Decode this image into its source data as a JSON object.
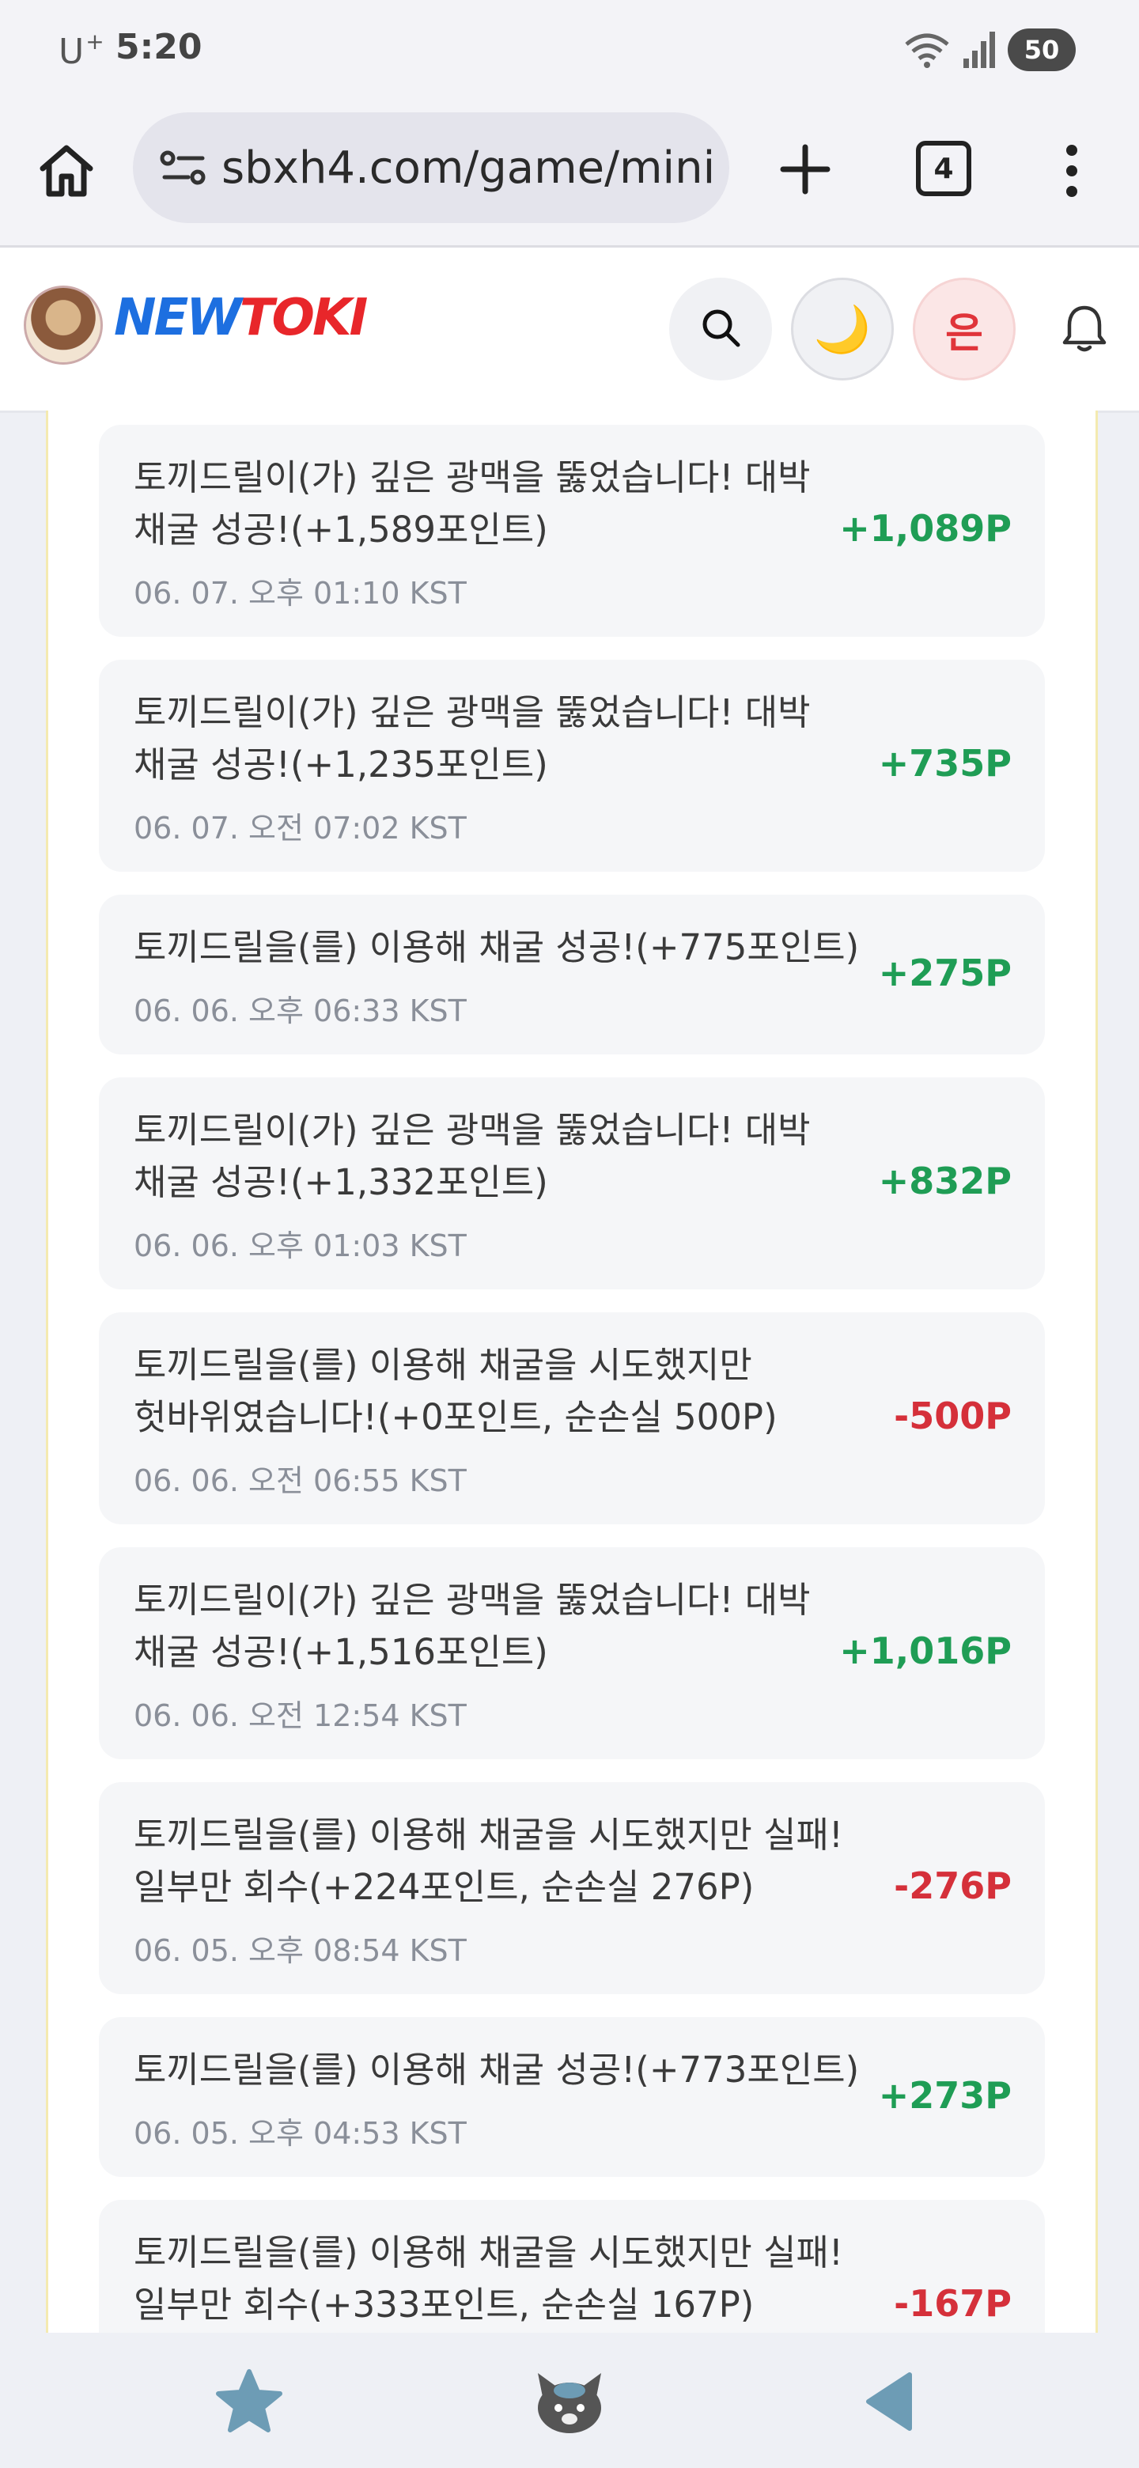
{
  "status_bar": {
    "carrier": "U",
    "carrier_plus": "+",
    "time": "5:20",
    "battery": "50"
  },
  "browser": {
    "url": "sbxh4.com/game/mini",
    "tab_count": "4"
  },
  "site": {
    "logo_new": "NEW",
    "logo_toki": "TOKI",
    "user_initial": "은",
    "theme_icon": "🌙"
  },
  "entries": [
    {
      "message": "토끼드릴이(가) 깊은 광맥을 뚫었습니다! 대박 채굴 성공!(+1,589포인트)",
      "date": "06. 07. 오후 01:10 KST",
      "amount": "+1,089P",
      "type": "positive"
    },
    {
      "message": "토끼드릴이(가) 깊은 광맥을 뚫었습니다! 대박 채굴 성공!(+1,235포인트)",
      "date": "06. 07. 오전 07:02 KST",
      "amount": "+735P",
      "type": "positive"
    },
    {
      "message": "토끼드릴을(를) 이용해 채굴 성공!(+775포인트)",
      "date": "06. 06. 오후 06:33 KST",
      "amount": "+275P",
      "type": "positive"
    },
    {
      "message": "토끼드릴이(가) 깊은 광맥을 뚫었습니다! 대박 채굴 성공!(+1,332포인트)",
      "date": "06. 06. 오후 01:03 KST",
      "amount": "+832P",
      "type": "positive"
    },
    {
      "message": "토끼드릴을(를) 이용해 채굴을 시도했지만 헛바위였습니다!(+0포인트, 순손실 500P)",
      "date": "06. 06. 오전 06:55 KST",
      "amount": "-500P",
      "type": "negative"
    },
    {
      "message": "토끼드릴이(가) 깊은 광맥을 뚫었습니다! 대박 채굴 성공!(+1,516포인트)",
      "date": "06. 06. 오전 12:54 KST",
      "amount": "+1,016P",
      "type": "positive"
    },
    {
      "message": "토끼드릴을(를) 이용해 채굴을 시도했지만 실패! 일부만 회수(+224포인트, 순손실 276P)",
      "date": "06. 05. 오후 08:54 KST",
      "amount": "-276P",
      "type": "negative"
    },
    {
      "message": "토끼드릴을(를) 이용해 채굴 성공!(+773포인트)",
      "date": "06. 05. 오후 04:53 KST",
      "amount": "+273P",
      "type": "positive"
    },
    {
      "message": "토끼드릴을(를) 이용해 채굴을 시도했지만 실패! 일부만 회수(+333포인트, 순손실 167P)",
      "date": "",
      "amount": "-167P",
      "type": "negative"
    }
  ],
  "icons": {
    "home": "home-icon",
    "site_info": "site-info-icon",
    "new_tab": "plus-icon",
    "menu": "more-vert-icon",
    "search": "search-icon",
    "bell": "bell-icon",
    "star": "star-icon",
    "mascot": "mascot-icon",
    "back": "back-triangle-icon"
  },
  "colors": {
    "positive": "#1f9d55",
    "negative": "#d5303a",
    "logo_blue": "#1d6fe0",
    "logo_red": "#e8262a"
  }
}
